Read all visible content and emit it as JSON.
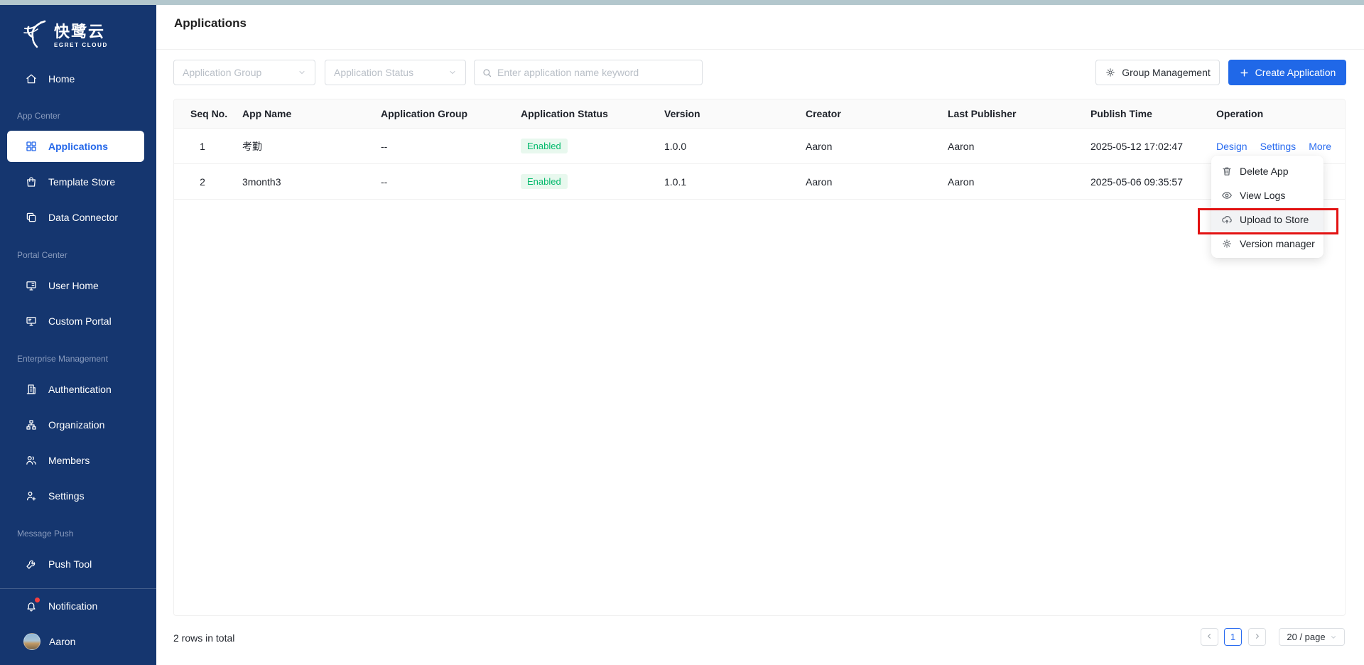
{
  "sidebar": {
    "logo_title": "快鹭云",
    "logo_subtitle": "EGRET CLOUD",
    "items": {
      "home": "Home",
      "app_center": "App Center",
      "applications": "Applications",
      "template_store": "Template Store",
      "data_connector": "Data Connector",
      "portal_center": "Portal Center",
      "user_home": "User Home",
      "custom_portal": "Custom Portal",
      "enterprise_management": "Enterprise Management",
      "authentication": "Authentication",
      "organization": "Organization",
      "members": "Members",
      "settings": "Settings",
      "message_push": "Message Push",
      "push_tool": "Push Tool",
      "notification": "Notification",
      "user_name": "Aaron"
    }
  },
  "header": {
    "title": "Applications"
  },
  "filters": {
    "group_placeholder": "Application Group",
    "status_placeholder": "Application Status",
    "search_placeholder": "Enter application name keyword"
  },
  "toolbar": {
    "group_management": "Group Management",
    "create_application": "Create Application"
  },
  "table": {
    "columns": [
      "Seq No.",
      "App Name",
      "Application Group",
      "Application Status",
      "Version",
      "Creator",
      "Last Publisher",
      "Publish Time",
      "Operation"
    ],
    "rows": [
      {
        "seq": "1",
        "app_name": "考勤",
        "group": "--",
        "status": "Enabled",
        "version": "1.0.0",
        "creator": "Aaron",
        "last_publisher": "Aaron",
        "publish_time": "2025-05-12 17:02:47",
        "ops": [
          "Design",
          "Settings",
          "More"
        ]
      },
      {
        "seq": "2",
        "app_name": "3month3",
        "group": "--",
        "status": "Enabled",
        "version": "1.0.1",
        "creator": "Aaron",
        "last_publisher": "Aaron",
        "publish_time": "2025-05-06 09:35:57"
      }
    ]
  },
  "menu": {
    "items": [
      {
        "label": "Delete App"
      },
      {
        "label": "View Logs"
      },
      {
        "label": "Upload to Store"
      },
      {
        "label": "Version manager"
      }
    ]
  },
  "pagination": {
    "total_text": "2 rows in total",
    "current_page": "1",
    "page_size": "20 / page"
  },
  "colors": {
    "sidebar_bg": "#15366f",
    "accent_blue": "#2a6cf0",
    "primary_button_bg": "#2068e8",
    "enabled_text": "#00b96b",
    "enabled_bg": "#e8f8ee",
    "annotation_red": "#e21212",
    "top_strip": "#b3c7cd",
    "notification_dot": "#f53f3f"
  }
}
